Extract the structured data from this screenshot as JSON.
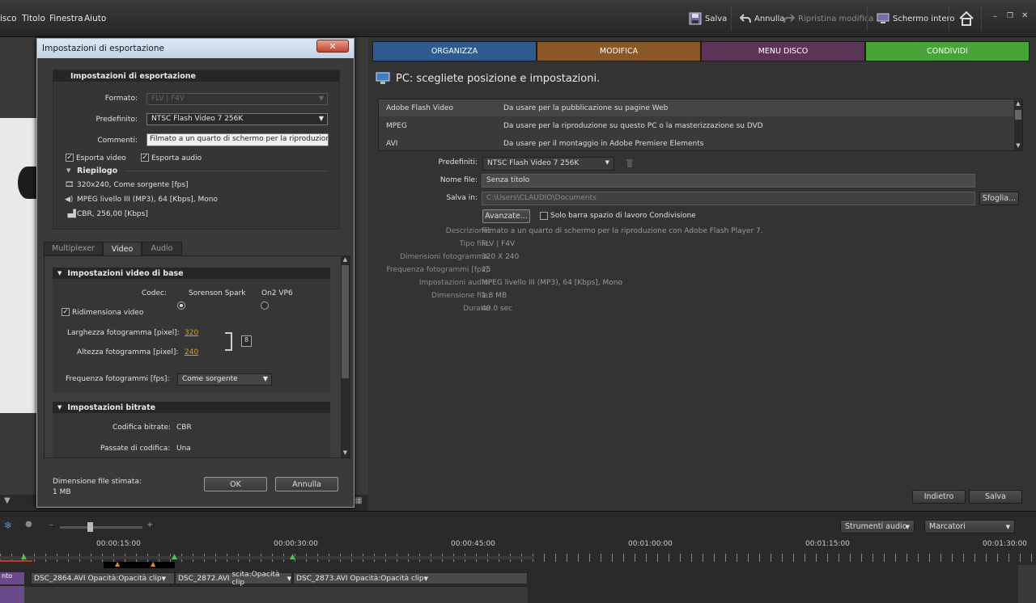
{
  "menu": [
    "isco",
    "Titolo",
    "Finestra",
    "Aiuto"
  ],
  "toolbar": {
    "save": "Salva",
    "undo": "Annulla",
    "redo": "Ripristina modifica",
    "fullscreen": "Schermo intero"
  },
  "tabs": [
    {
      "label": "ORGANIZZA",
      "color": "#2f5b8f"
    },
    {
      "label": "MODIFICA",
      "color": "#8a5726"
    },
    {
      "label": "MENU DISCO",
      "color": "#5b3458"
    },
    {
      "label": "CONDIVIDI",
      "color": "#46a536"
    }
  ],
  "share": {
    "title": "PC: scegliete posizione e impostazioni.",
    "formats": [
      {
        "name": "Adobe Flash Video",
        "desc": "Da usare per la pubblicazione su pagine Web"
      },
      {
        "name": "MPEG",
        "desc": "Da usare per la riproduzione su questo PC o la masterizzazione su DVD"
      },
      {
        "name": "AVI",
        "desc": "Da usare per il montaggio in Adobe Premiere Elements"
      }
    ],
    "preset_label": "Predefiniti:",
    "preset_value": "NTSC Flash Video 7 256K",
    "filename_label": "Nome file:",
    "filename_value": "Senza titolo",
    "savein_label": "Salva in:",
    "savein_value": "C:\\Users\\CLAUDIO\\Documents",
    "browse": "Sfoglia...",
    "advanced": "Avanzate...",
    "workspace_only": "Solo barra spazio di lavoro Condivisione",
    "info": [
      {
        "label": "Descrizione:",
        "value": "Filmato a un quarto di schermo per la riproduzione con Adobe Flash Player 7."
      },
      {
        "label": "Tipo file:",
        "value": "FLV | F4V"
      },
      {
        "label": "Dimensioni fotogramma:",
        "value": "320 X 240"
      },
      {
        "label": "Frequenza fotogrammi [fps]:",
        "value": "25"
      },
      {
        "label": "Impostazioni audio:",
        "value": "MPEG livello III (MP3), 64 [Kbps], Mono"
      },
      {
        "label": "Dimensione file:",
        "value": "1.8 MB"
      },
      {
        "label": "Durata:",
        "value": "49.0 sec"
      }
    ],
    "back": "Indietro",
    "save": "Salva"
  },
  "dialog": {
    "title": "Impostazioni di esportazione",
    "close": "✕",
    "group_title": "Impostazioni di esportazione",
    "format_label": "Formato:",
    "format_value": "FLV | F4V",
    "preset_label": "Predefinito:",
    "preset_value": "NTSC Flash Video 7 256K",
    "comments_label": "Commenti:",
    "comments_value": "Filmato a un quarto di schermo per la riproduzione co",
    "export_video": "Esporta video",
    "export_audio": "Esporta audio",
    "summary": "Riepilogo",
    "summary_lines": [
      "320x240, Come sorgente [fps]",
      "MPEG livello III (MP3), 64 [Kbps], Mono",
      "CBR, 256,00 [Kbps]"
    ],
    "tabs": [
      "Multiplexer",
      "Video",
      "Audio"
    ],
    "video_basic": "Impostazioni video di base",
    "codec_label": "Codec:",
    "codec_opt1": "Sorenson Spark",
    "codec_opt2": "On2 VP6",
    "resize": "Ridimensiona video",
    "width_label": "Larghezza fotogramma [pixel]:",
    "width_value": "320",
    "height_label": "Altezza fotogramma [pixel]:",
    "height_value": "240",
    "fps_label": "Frequenza fotogrammi [fps]:",
    "fps_value": "Come sorgente",
    "bitrate_title": "Impostazioni bitrate",
    "bitrate_enc_label": "Codifica bitrate:",
    "bitrate_enc_value": "CBR",
    "passes_label": "Passate di codifica:",
    "passes_value": "Una",
    "est_label": "Dimensione file stimata:",
    "est_value": "1 MB",
    "ok": "OK",
    "cancel": "Annulla"
  },
  "timeline": {
    "audio_tools": "Strumenti audio",
    "markers": "Marcatori",
    "timecodes": [
      "00:00:15:00",
      "00:00:30:00",
      "00:00:45:00",
      "00:01:00:00",
      "00:01:15:00",
      "00:01:30:00"
    ],
    "clips": [
      {
        "name": "DSC_2864.AVI",
        "fx": "Opacità:Opacità clip"
      },
      {
        "name": "DSC_2872.AVI",
        "fx": "scita:Opacità clip"
      },
      {
        "name": "DSC_2873.AVI",
        "fx": "Opacità:Opacità clip"
      }
    ],
    "track_label": "nto"
  }
}
